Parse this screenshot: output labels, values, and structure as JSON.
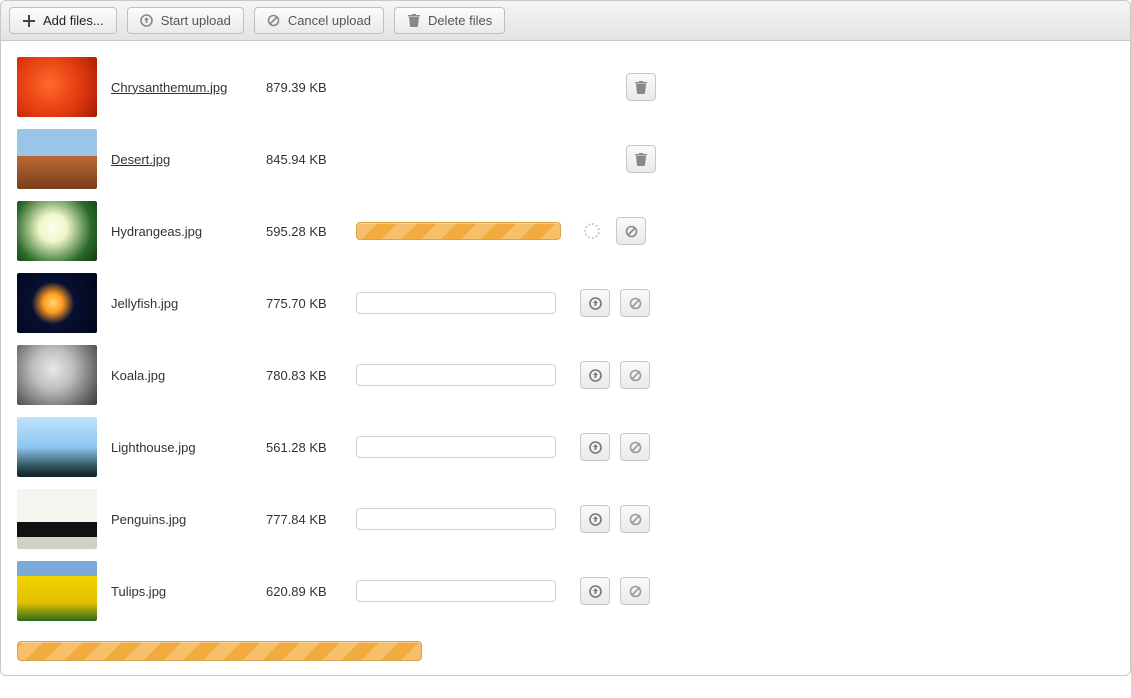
{
  "toolbar": {
    "add_label": "Add files...",
    "start_label": "Start upload",
    "cancel_label": "Cancel upload",
    "delete_label": "Delete files"
  },
  "files": [
    {
      "name": "Chrysanthemum.jpg",
      "size": "879.39 KB",
      "state": "done"
    },
    {
      "name": "Desert.jpg",
      "size": "845.94 KB",
      "state": "done"
    },
    {
      "name": "Hydrangeas.jpg",
      "size": "595.28 KB",
      "state": "uploading"
    },
    {
      "name": "Jellyfish.jpg",
      "size": "775.70 KB",
      "state": "queued"
    },
    {
      "name": "Koala.jpg",
      "size": "780.83 KB",
      "state": "queued"
    },
    {
      "name": "Lighthouse.jpg",
      "size": "561.28 KB",
      "state": "queued"
    },
    {
      "name": "Penguins.jpg",
      "size": "777.84 KB",
      "state": "queued"
    },
    {
      "name": "Tulips.jpg",
      "size": "620.89 KB",
      "state": "queued"
    }
  ],
  "total_progress_percent": 36,
  "icons": {
    "plus": "plus-icon",
    "upload": "upload-circle-icon",
    "cancel": "ban-icon",
    "trash": "trash-icon"
  }
}
